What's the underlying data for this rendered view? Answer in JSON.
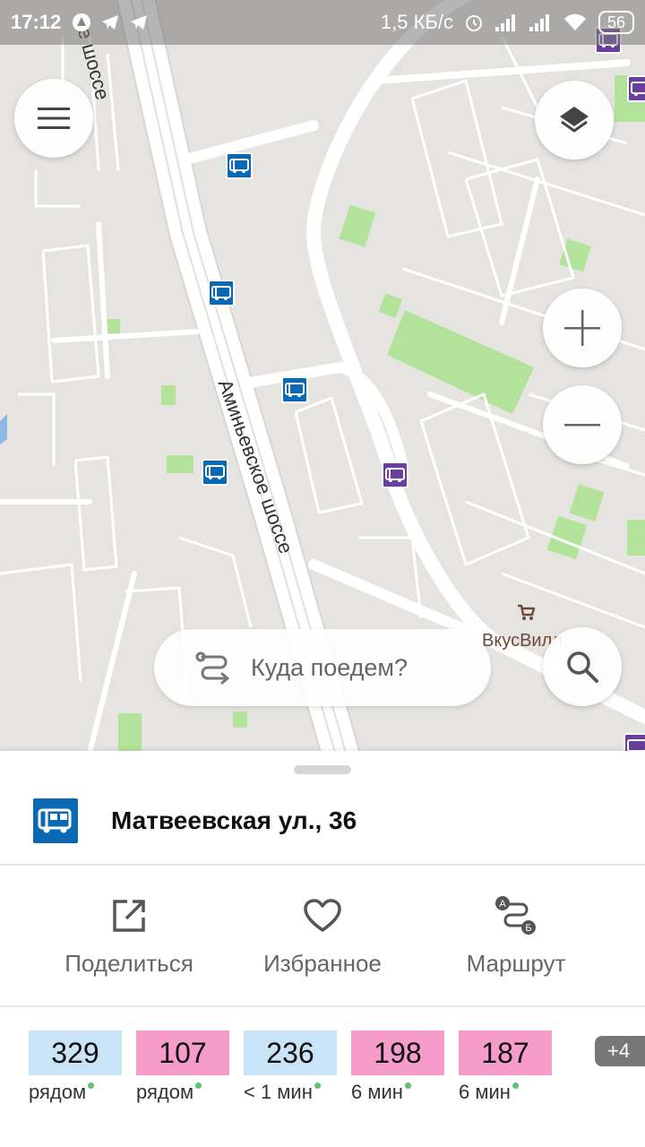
{
  "status_bar": {
    "time": "17:12",
    "network_speed": "1,5 КБ/с",
    "battery": "56",
    "icons": [
      "app-icon",
      "telegram-icon",
      "telegram-icon",
      "alarm-icon",
      "signal-icon",
      "signal-icon",
      "wifi-icon"
    ]
  },
  "map": {
    "roads": {
      "road_top": "е шоссе",
      "aminyevskoe": "Аминьевское шоссе"
    },
    "poi": {
      "shop": "ВкусВилл"
    },
    "buttons": {
      "menu": "menu-icon",
      "layers": "layers-icon",
      "zoom_in": "plus-icon",
      "zoom_out": "minus-icon",
      "search": "search-icon"
    },
    "colors": {
      "bus_stop": "#0a69b4",
      "trolley_stop": "#6a3e9d",
      "park": "#b3e29a",
      "road": "#ffffff",
      "ground": "#e6e4e1"
    }
  },
  "search": {
    "placeholder": "Куда поедем?"
  },
  "stop": {
    "name": "Матвеевская ул., 36",
    "icon": "bus-stop-icon"
  },
  "actions": {
    "share": "Поделиться",
    "favorite": "Избранное",
    "route": "Маршрут"
  },
  "routes": [
    {
      "number": "329",
      "when": "рядом",
      "type": "bus"
    },
    {
      "number": "107",
      "when": "рядом",
      "type": "trolley"
    },
    {
      "number": "236",
      "when": "< 1 мин",
      "type": "bus"
    },
    {
      "number": "198",
      "when": "6 мин",
      "type": "trolley"
    },
    {
      "number": "187",
      "when": "6 мин",
      "type": "trolley"
    }
  ],
  "more_routes": "+4"
}
